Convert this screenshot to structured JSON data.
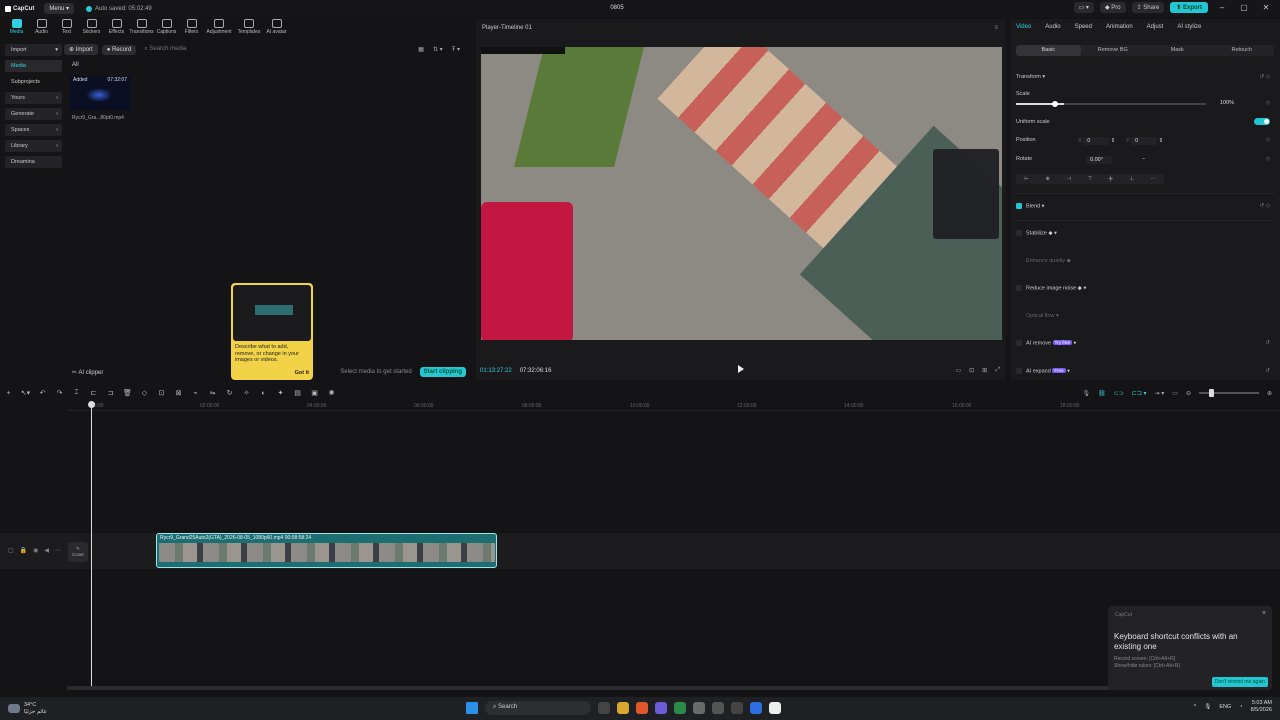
{
  "titlebar": {
    "app": "CapCut",
    "menu": "Menu",
    "autosave": "Auto saved: 05:02:49",
    "project": "0805",
    "pro": "Pro",
    "share": "Share",
    "export": "Export"
  },
  "toolbar": [
    "Media",
    "Audio",
    "Text",
    "Stickers",
    "Effects",
    "Transitions",
    "Captions",
    "Filters",
    "Adjustment",
    "Templates",
    "AI avatar"
  ],
  "sidebar": [
    "Import",
    "Media",
    "Subprojects",
    "Yours",
    "Generate",
    "Spaces",
    "Library",
    "Dreamina"
  ],
  "media": {
    "import": "Import",
    "record": "Record",
    "search_placeholder": "Search media",
    "filter": "All",
    "clip_added": "Added",
    "clip_duration": "07:32:07",
    "clip_name": "Rycr9_Gra...80pt0.mp4"
  },
  "tooltip": {
    "text": "Describe what to add, remove, or change in your images or videos.",
    "button": "Got it"
  },
  "media_bottom": {
    "ai_clipper": "AI clipper",
    "hint": "Select media to get started",
    "start": "Start clipping"
  },
  "player": {
    "title": "Player-Timeline 01",
    "current": "01:13:27:22",
    "total": "07:32:06:16"
  },
  "props": {
    "tabs": [
      "Video",
      "Audio",
      "Speed",
      "Animation",
      "Adjust",
      "AI stylize"
    ],
    "subtabs": [
      "Basic",
      "Remove BG",
      "Mask",
      "Retouch"
    ],
    "transform": "Transform",
    "scale": "Scale",
    "scale_value": "100%",
    "uniform": "Uniform scale",
    "position": "Position",
    "pos_x_label": "X",
    "pos_x": "0",
    "pos_y_label": "Y",
    "pos_y": "0",
    "rotate": "Rotate",
    "rotate_value": "0.00°",
    "blend": "Blend",
    "stabilize": "Stabilize",
    "enhance": "Enhance quality",
    "reduce_noise": "Reduce image noise",
    "optical_flow": "Optical flow",
    "ai_remove": "AI remove",
    "ai_remove_tag": "Try free",
    "ai_expand": "AI expand",
    "ai_expand_tag": "Free"
  },
  "timeline": {
    "ruler": [
      "00:00",
      "02:00:00",
      "04:00:00",
      "06:00:00",
      "08:00:00",
      "10:00:00",
      "12:00:00",
      "14:00:00",
      "16:00:00",
      "18:00:00"
    ],
    "cover": "Cover",
    "clip_label": "Rycr9_Grand25Auto2(GTA)_2026-08-05_1080p60.mp4",
    "clip_duration": "00:08:58:24"
  },
  "toast": {
    "source": "CapCut",
    "title": "Keyboard shortcut conflicts with an existing one",
    "line1": "Record screen: [Ctrl+Alt+R]",
    "line2": "Show/hide rulers: [Ctrl+Alt+R]",
    "button": "Don't remind me again"
  },
  "taskbar": {
    "temp": "34°C",
    "weather_note": "غائم جزئيًا",
    "search": "Search",
    "lang": "ENG",
    "time": "5:03 AM",
    "date": "8/5/2026"
  },
  "colors": {
    "accent": "#22c7d3",
    "bg": "#141416"
  }
}
